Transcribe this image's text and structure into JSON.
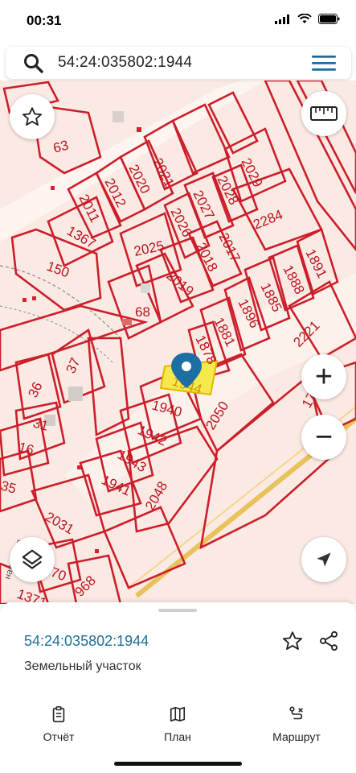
{
  "status": {
    "time": "00:31"
  },
  "search": {
    "query": "54:24:035802:1944"
  },
  "map": {
    "highlight_color": "#f6e94a",
    "boundary_color": "#cc1f2b",
    "road_label": "ная улица",
    "parcels": {
      "p63": "63",
      "p2021": "2021",
      "p2020": "2020",
      "p2029": "2029",
      "p2012": "2012",
      "p2028": "2028",
      "p2011": "2011",
      "p2027": "2027",
      "p2284": "2284",
      "p2026": "2026",
      "p1367": "1367",
      "p2025": "2025",
      "p2017": "2017",
      "p2018": "2018",
      "p1891": "1891",
      "p150": "150",
      "p1888": "1888",
      "p2019": "2019",
      "p68": "68",
      "p1885": "1885",
      "p1896": "1896",
      "p2221": "2221",
      "p1881": "1881",
      "p1878": "1878",
      "p37": "37",
      "p1944": "1944",
      "p36": "36",
      "p1940": "1940",
      "p2050": "2050",
      "p17": "17",
      "p31": "31",
      "p1942": "1942",
      "p16": "16",
      "p1943": "1943",
      "p1941": "1941",
      "p35": "35",
      "p2048": "2048",
      "p2031": "2031",
      "p70": "70",
      "p1371": "1371",
      "p968": "968"
    }
  },
  "controls": {
    "favorite_icon": "star-icon",
    "ruler_icon": "ruler-icon",
    "zoom_in": "+",
    "zoom_out": "−",
    "layers_icon": "layers-icon",
    "location_icon": "navigation-arrow-icon"
  },
  "sheet": {
    "parcel_id": "54:24:035802:1944",
    "parcel_type": "Земельный участок"
  },
  "tabs": {
    "report": "Отчёт",
    "plan": "План",
    "route": "Маршрут"
  }
}
